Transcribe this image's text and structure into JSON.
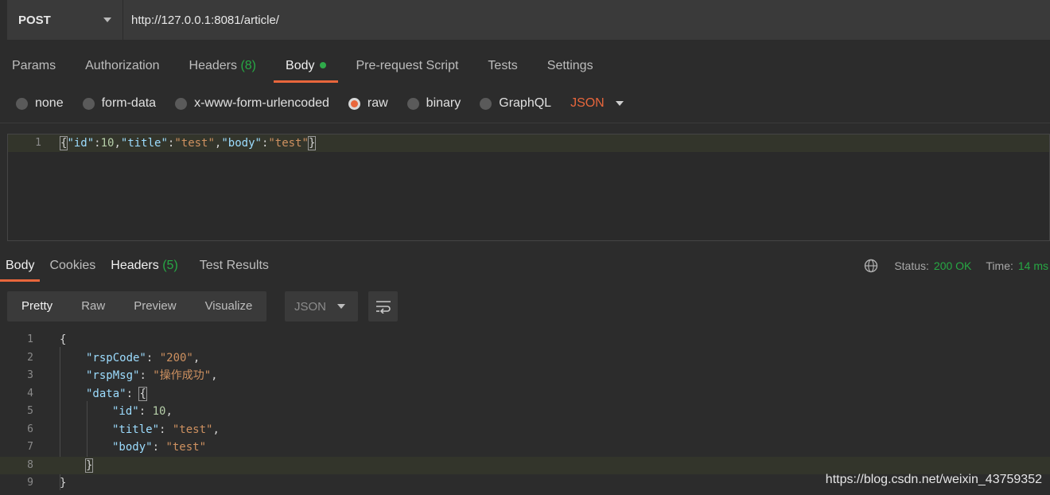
{
  "request": {
    "method": "POST",
    "url": "http://127.0.0.1:8081/article/"
  },
  "request_tabs": [
    {
      "label": "Params"
    },
    {
      "label": "Authorization"
    },
    {
      "label": "Headers",
      "count": "(8)"
    },
    {
      "label": "Body"
    },
    {
      "label": "Pre-request Script"
    },
    {
      "label": "Tests"
    },
    {
      "label": "Settings"
    }
  ],
  "body_types": {
    "none": "none",
    "form_data": "form-data",
    "urlencoded": "x-www-form-urlencoded",
    "raw": "raw",
    "binary": "binary",
    "graphql": "GraphQL",
    "format": "JSON",
    "selected": "raw"
  },
  "request_body": {
    "line_number": "1",
    "tokens": [
      "{",
      "\"id\"",
      ":",
      "10",
      ",",
      "\"title\"",
      ":",
      "\"test\"",
      ",",
      "\"body\"",
      ":",
      "\"test\"",
      "}"
    ]
  },
  "response_tabs": [
    {
      "label": "Body"
    },
    {
      "label": "Cookies"
    },
    {
      "label": "Headers",
      "count": "(5)"
    },
    {
      "label": "Test Results"
    }
  ],
  "status": {
    "status_label": "Status:",
    "status_value": "200 OK",
    "time_label": "Time:",
    "time_value": "14 ms"
  },
  "view_modes": [
    "Pretty",
    "Raw",
    "Preview",
    "Visualize"
  ],
  "response_format": "JSON",
  "response_body": {
    "line_numbers": [
      "1",
      "2",
      "3",
      "4",
      "5",
      "6",
      "7",
      "8",
      "9"
    ],
    "open_brace": "{",
    "close_brace": "}",
    "rspCode_key": "\"rspCode\"",
    "rspCode_value": "\"200\"",
    "rspMsg_key": "\"rspMsg\"",
    "rspMsg_value": "\"操作成功\"",
    "data_key": "\"data\"",
    "id_key": "\"id\"",
    "id_value": "10",
    "title_key": "\"title\"",
    "title_value": "\"test\"",
    "body_key": "\"body\"",
    "body_value": "\"test\"",
    "colon": ": ",
    "comma": ","
  },
  "watermark": "https://blog.csdn.net/weixin_43759352",
  "colors": {
    "accent": "#e8663c",
    "success": "#27a844",
    "background": "#2c2c2c",
    "key": "#9cdcfe",
    "string": "#ce9160",
    "number": "#b5cea8"
  }
}
